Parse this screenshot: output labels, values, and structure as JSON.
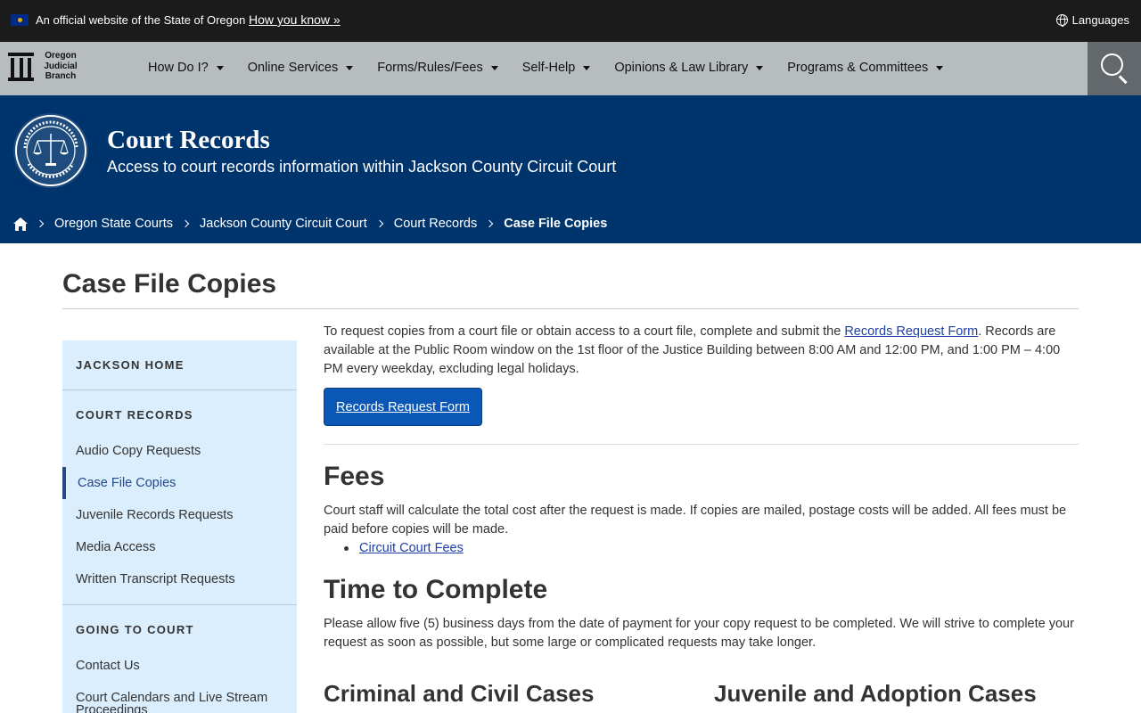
{
  "banner": {
    "official_text": "An official website of the State of Oregon",
    "how_link": "How you know »",
    "languages": "Languages"
  },
  "nav": {
    "logo_lines": [
      "Oregon",
      "Judicial",
      "Branch"
    ],
    "items": [
      {
        "label": "How Do I?"
      },
      {
        "label": "Online Services"
      },
      {
        "label": "Forms/Rules/Fees"
      },
      {
        "label": "Self-Help"
      },
      {
        "label": "Opinions & Law Library"
      },
      {
        "label": "Programs & Committees"
      }
    ]
  },
  "hero": {
    "title": "Court Records",
    "subtitle": "Access to court records information within Jackson County Circuit Court"
  },
  "breadcrumb": {
    "items": [
      "Oregon State Courts",
      "Jackson County Circuit Court",
      "Court Records"
    ],
    "current": "Case File Copies"
  },
  "page": {
    "title": "Case File Copies"
  },
  "sidebar": {
    "sections": [
      {
        "heading": "JACKSON HOME",
        "items": []
      },
      {
        "heading": "COURT RECORDS",
        "items": [
          "Audio Copy Requests",
          "Case File Copies",
          "Juvenile Records Requests",
          "Media Access",
          "Written Transcript Requests"
        ]
      },
      {
        "heading": "GOING TO COURT",
        "items": [
          "Contact Us",
          "Court Calendars and Live Stream Proceedings"
        ]
      }
    ],
    "active_item": "Case File Copies"
  },
  "main": {
    "intro_before": "To request copies from a court file or obtain access to a court file, complete and submit the ",
    "intro_link": "Records Request Form",
    "intro_after": ". Records are available at the Public Room window on the 1st floor of the Justice Building between 8:00 AM and 12:00 PM, and 1:00 PM – 4:00 PM every weekday, excluding legal holidays.",
    "button_label": "Records Request Form",
    "fees_heading": "Fees",
    "fees_text": "Court staff will calculate the total cost after the request is made. If copies are mailed, postage costs will be added. All fees must be paid before copies will be made.",
    "fees_link": "Circuit Court Fees",
    "time_heading": "Time to Complete",
    "time_text": "Please allow five (5) business days from the date of payment for your copy request to be completed. We will strive to complete your request as soon as possible, but some large or complicated requests may take longer.",
    "criminal_heading": "Criminal and Civil Cases",
    "juvenile_heading": "Juvenile and Adoption Cases"
  },
  "colors": {
    "banner_bg": "#1b1b1b",
    "nav_bg": "#b7bcbf",
    "hero_bg": "#00346d",
    "sidebar_bg": "#dbeefd",
    "accent": "#254987",
    "button_bg": "#0a57b5",
    "link": "#1e3fa6"
  },
  "icons": {
    "flag": "oregon-flag-icon",
    "globe": "globe-icon",
    "search": "search-icon",
    "home": "home-icon",
    "caret": "caret-down-icon",
    "seal": "judicial-seal-icon"
  }
}
